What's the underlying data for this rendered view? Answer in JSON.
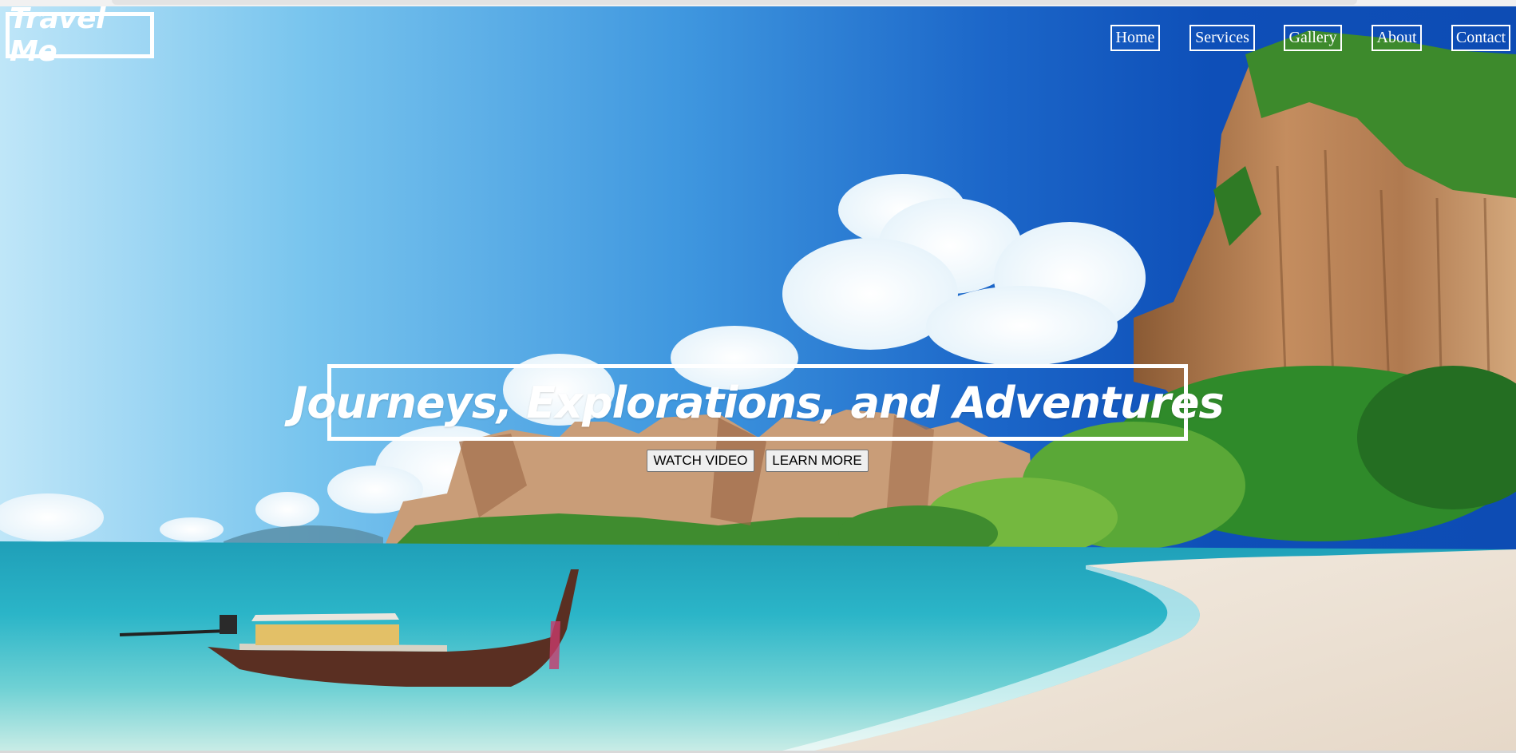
{
  "brand": {
    "logo": "Travel Me"
  },
  "nav": {
    "items": [
      {
        "label": "Home"
      },
      {
        "label": "Services"
      },
      {
        "label": "Gallery"
      },
      {
        "label": "About"
      },
      {
        "label": "Contact"
      }
    ]
  },
  "hero": {
    "headline": "Journeys, Explorations, and Adventures",
    "buttons": {
      "watch_video": "WATCH VIDEO",
      "learn_more": "LEARN MORE"
    }
  },
  "colors": {
    "sky_light": "#bfe6f8",
    "sky_deep": "#0d4cb4",
    "sea": "#2bb5c8",
    "sand": "#efe6dc",
    "foliage": "#2f8a2a",
    "cliff": "#b5835a"
  }
}
